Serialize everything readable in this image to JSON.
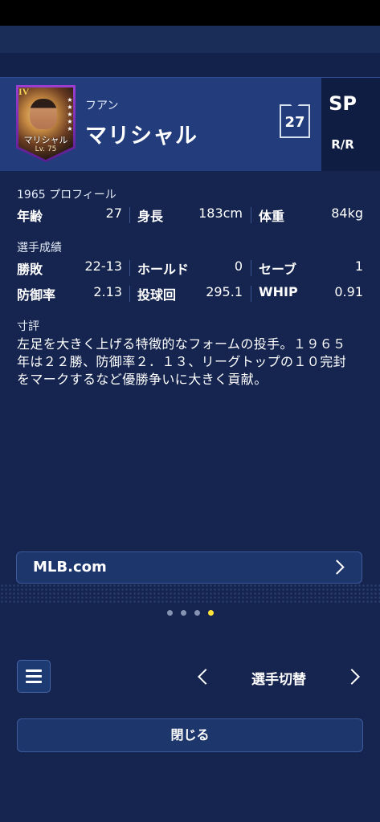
{
  "player": {
    "card_rank": "IV",
    "card_name": "マリシャル",
    "card_level": "Lv. 75",
    "kana": "フアン",
    "name": "マリシャル",
    "number": "27",
    "position": "SP",
    "handedness": "R/R"
  },
  "profile": {
    "title": "1965 プロフィール",
    "age_label": "年齢",
    "age_value": "27",
    "height_label": "身長",
    "height_value": "183cm",
    "weight_label": "体重",
    "weight_value": "84kg"
  },
  "stats": {
    "title": "選手成績",
    "record_label": "勝敗",
    "record_value": "22-13",
    "holds_label": "ホールド",
    "holds_value": "0",
    "saves_label": "セーブ",
    "saves_value": "1",
    "era_label": "防御率",
    "era_value": "2.13",
    "innings_label": "投球回",
    "innings_value": "295.1",
    "whip_label": "WHIP",
    "whip_value": "0.91"
  },
  "review": {
    "title": "寸評",
    "text": "左足を大きく上げる特徴的なフォームの投手。１９６５年は２２勝、防御率２．１３、リーグトップの１０完封をマークするなど優勝争いに大きく貢献。"
  },
  "link": {
    "label": "MLB.com"
  },
  "pager": {
    "count": 4,
    "active_index": 3
  },
  "footer": {
    "switch_label": "選手切替",
    "close_label": "閉じる"
  },
  "colors": {
    "background": "#15254f",
    "header": "#233d7c",
    "accent_dot": "#ffe23a"
  }
}
